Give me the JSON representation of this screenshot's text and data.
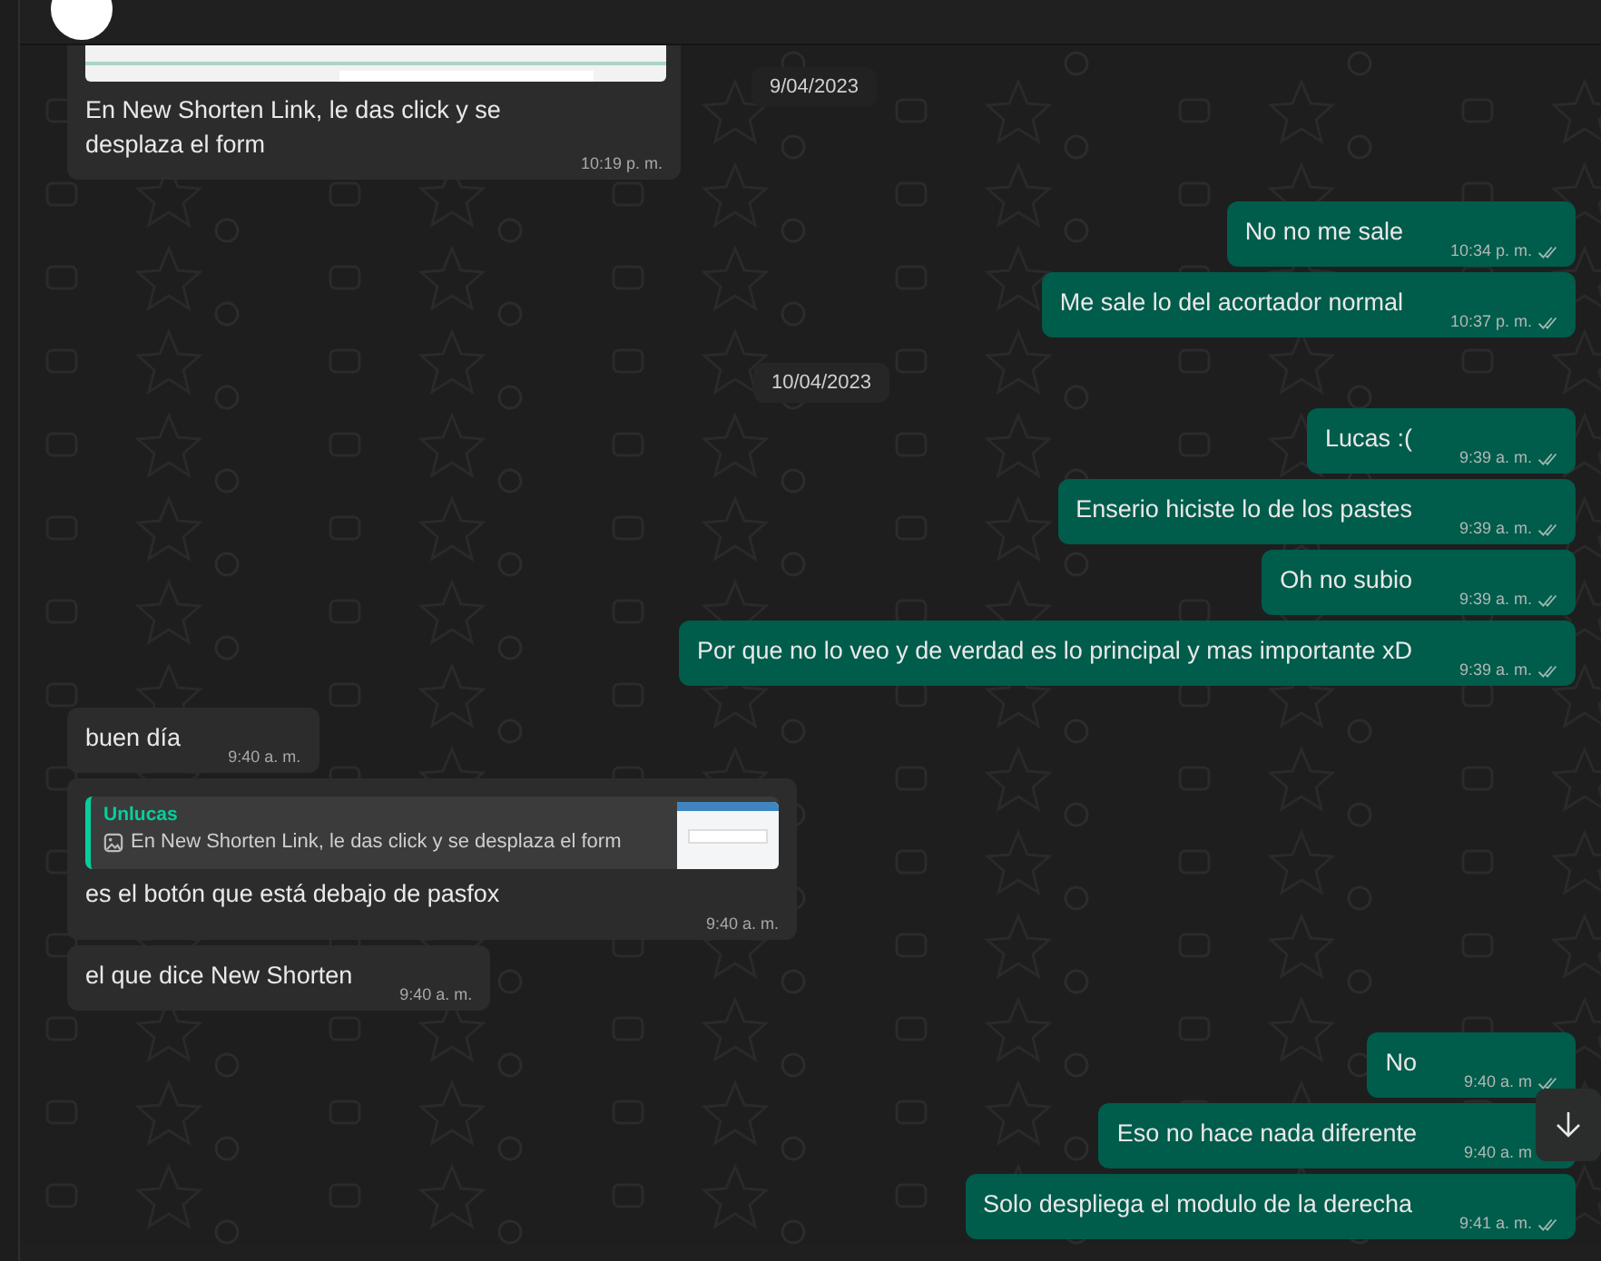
{
  "header": {
    "avatar": true
  },
  "floating_date": "9/04/2023",
  "messages": [
    {
      "kind": "received",
      "screenshot": true,
      "text": "En New Shorten Link, le das click y se desplaza el form",
      "time": "10:19 p. m.",
      "ticks": false
    },
    {
      "kind": "sent",
      "text": "No no me sale",
      "time": "10:34 p. m.",
      "ticks": true
    },
    {
      "kind": "sent",
      "text": "Me sale lo del acortador normal",
      "time": "10:37 p. m.",
      "ticks": true
    },
    {
      "kind": "date",
      "text": "10/04/2023"
    },
    {
      "kind": "sent",
      "text": "Lucas :(",
      "time": "9:39 a. m.",
      "ticks": true
    },
    {
      "kind": "sent",
      "text": "Enserio hiciste lo de los pastes",
      "time": "9:39 a. m.",
      "ticks": true
    },
    {
      "kind": "sent",
      "text": "Oh no subio",
      "time": "9:39 a. m.",
      "ticks": true
    },
    {
      "kind": "sent",
      "text": "Por que no lo veo y de verdad es lo principal y mas importante xD",
      "time": "9:39 a. m.",
      "ticks": true
    },
    {
      "kind": "received",
      "text": "buen día",
      "time": "9:40 a. m.",
      "ticks": false
    },
    {
      "kind": "received",
      "quote": {
        "author": "Unlucas",
        "text": "En New Shorten Link, le das click y se desplaza el form"
      },
      "text": "es el botón que está debajo de pasfox",
      "time": "9:40 a. m.",
      "ticks": false
    },
    {
      "kind": "received",
      "text": "el que dice New Shorten",
      "time": "9:40 a. m.",
      "ticks": false
    },
    {
      "kind": "sent",
      "text": "No",
      "time": "9:40 a. m",
      "ticks": true
    },
    {
      "kind": "sent",
      "text": "Eso no hace nada diferente",
      "time": "9:40 a. m",
      "ticks": false
    },
    {
      "kind": "sent",
      "text": "Solo despliega el modulo de la derecha",
      "time": "9:41 a. m.",
      "ticks": true
    }
  ],
  "scroll_down_button": true
}
